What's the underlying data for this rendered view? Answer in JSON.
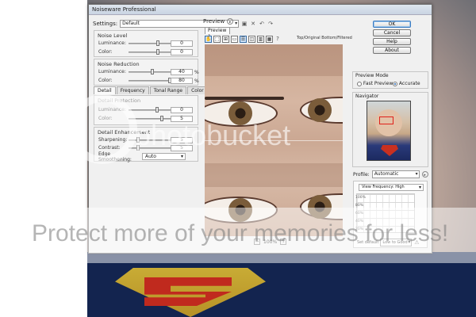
{
  "window": {
    "title": "Noiseware Professional"
  },
  "settings": {
    "label": "Settings:",
    "value": "Default"
  },
  "noise_level": {
    "title": "Noise Level",
    "luminance": {
      "label": "Luminance:",
      "value": "0"
    },
    "color": {
      "label": "Color:",
      "value": "0"
    }
  },
  "noise_reduction": {
    "title": "Noise Reduction",
    "luminance": {
      "label": "Luminance:",
      "value": "40",
      "unit": "%"
    },
    "color": {
      "label": "Color:",
      "value": "80",
      "unit": "%"
    }
  },
  "tabs": [
    "Detail",
    "Frequency",
    "Tonal Range",
    "Color Range"
  ],
  "detail_protection": {
    "title": "Detail Protection",
    "luminance": {
      "label": "Luminance:",
      "value": "0"
    },
    "color": {
      "label": "Color:",
      "value": "5"
    }
  },
  "detail_enhancement": {
    "title": "Detail Enhancement",
    "sharpening": {
      "label": "Sharpening:",
      "value": "5"
    },
    "contrast": {
      "label": "Contrast:",
      "value": "5"
    },
    "edge_smoothening": {
      "label": "Edge Smoothening:",
      "value": "Auto"
    }
  },
  "preview": {
    "label": "Preview",
    "tab": "Preview 1",
    "mode": "Top/Original Bottom/Filtered",
    "zoom": "100%",
    "help_glyph": "?"
  },
  "buttons": {
    "ok": "OK",
    "cancel": "Cancel",
    "help": "Help",
    "about": "About"
  },
  "preview_mode": {
    "title": "Preview Mode",
    "fast": "Fast Preview",
    "accurate": "Accurate"
  },
  "navigator": {
    "title": "Navigator"
  },
  "profile": {
    "label": "Profile:",
    "value": "Automatic",
    "view": "View Frequency: High",
    "levels": [
      "100%",
      "80%",
      "60%",
      "40%",
      "20%"
    ]
  },
  "bottom": {
    "label": "Set default",
    "value": "Low to Good"
  },
  "watermark": {
    "main": "photobucket",
    "band": "Protect more of your memories for less!"
  },
  "colors": {
    "accent": "#3b7cc3",
    "window_bg": "#f0f0f0",
    "titlebar": "#c9d4e2"
  }
}
